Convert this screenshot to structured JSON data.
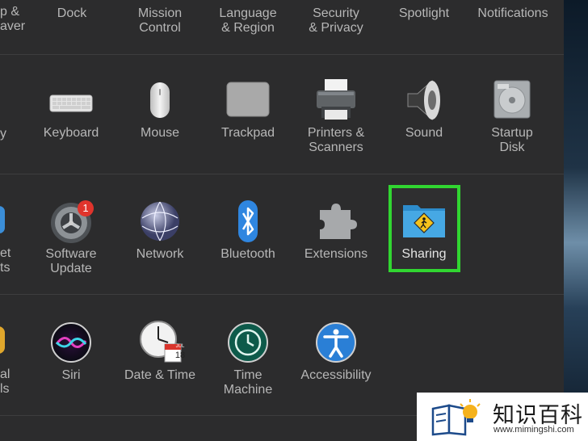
{
  "top_row": {
    "edge_label": [
      "p &",
      "aver"
    ],
    "items": [
      {
        "label": "Dock"
      },
      {
        "label": "Mission Control",
        "lines": [
          "Mission",
          "Control"
        ]
      },
      {
        "label": "Language & Region",
        "lines": [
          "Language",
          "& Region"
        ]
      },
      {
        "label": "Security & Privacy",
        "lines": [
          "Security",
          "& Privacy"
        ]
      },
      {
        "label": "Spotlight"
      },
      {
        "label": "Notifications"
      }
    ]
  },
  "row2": {
    "edge_label": "y",
    "items": [
      {
        "name": "Keyboard",
        "icon": "keyboard-icon"
      },
      {
        "name": "Mouse",
        "icon": "mouse-icon"
      },
      {
        "name": "Trackpad",
        "icon": "trackpad-icon"
      },
      {
        "name": "Printers & Scanners",
        "lines": [
          "Printers &",
          "Scanners"
        ],
        "icon": "printer-icon"
      },
      {
        "name": "Sound",
        "icon": "speaker-icon"
      },
      {
        "name": "Startup Disk",
        "lines": [
          "Startup",
          "Disk"
        ],
        "icon": "hard-disk-icon"
      }
    ]
  },
  "row3": {
    "edge_label": [
      "et",
      "ts"
    ],
    "items": [
      {
        "name": "Software Update",
        "lines": [
          "Software",
          "Update"
        ],
        "icon": "software-update-gear-icon",
        "badge": "1"
      },
      {
        "name": "Network",
        "icon": "network-globe-icon"
      },
      {
        "name": "Bluetooth",
        "icon": "bluetooth-icon"
      },
      {
        "name": "Extensions",
        "icon": "puzzle-piece-icon"
      },
      {
        "name": "Sharing",
        "icon": "sharing-folder-icon",
        "highlighted": true
      }
    ]
  },
  "row4": {
    "edge_label": [
      "al",
      "ls"
    ],
    "items": [
      {
        "name": "Siri",
        "icon": "siri-icon"
      },
      {
        "name": "Date & Time",
        "icon": "clock-calendar-icon",
        "calendar_month": "JUL",
        "calendar_day": "18"
      },
      {
        "name": "Time Machine",
        "lines": [
          "Time",
          "Machine"
        ],
        "icon": "time-machine-icon"
      },
      {
        "name": "Accessibility",
        "icon": "accessibility-icon"
      }
    ]
  },
  "watermark": {
    "text": "知识百科",
    "url": "www.mimingshi.com",
    "icon": "book-lightbulb-icon"
  },
  "colors": {
    "highlight": "#31d631",
    "panel_bg": "#2c2c2d",
    "badge_red": "#e0342c",
    "folder_blue": "#3da0d8"
  }
}
